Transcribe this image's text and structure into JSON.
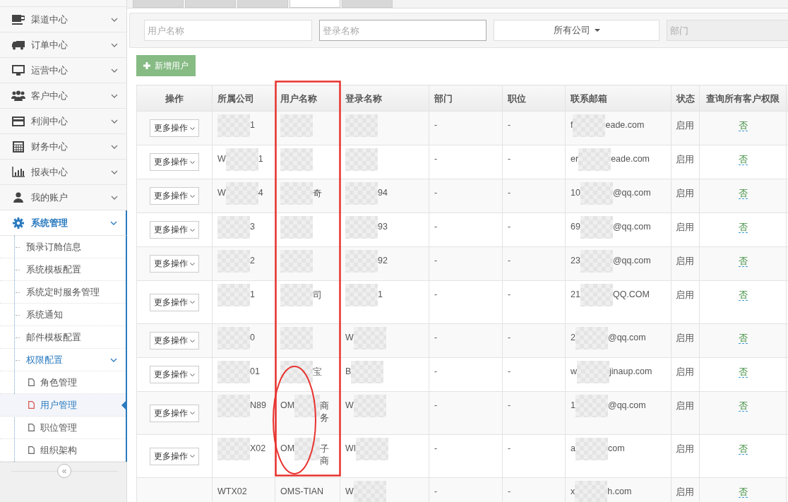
{
  "sidebar": {
    "items": [
      {
        "label": "渠道中心",
        "selected": false
      },
      {
        "label": "订单中心",
        "selected": false
      },
      {
        "label": "运营中心",
        "selected": false
      },
      {
        "label": "客户中心",
        "selected": false
      },
      {
        "label": "利润中心",
        "selected": false
      },
      {
        "label": "财务中心",
        "selected": false
      },
      {
        "label": "报表中心",
        "selected": false
      },
      {
        "label": "我的账户",
        "selected": false
      },
      {
        "label": "系统管理",
        "selected": true,
        "expanded": true,
        "children": [
          {
            "label": "预录订舱信息",
            "selected": false
          },
          {
            "label": "系统模板配置",
            "selected": false
          },
          {
            "label": "系统定时服务管理",
            "selected": false
          },
          {
            "label": "系统通知",
            "selected": false
          },
          {
            "label": "邮件模板配置",
            "selected": false
          },
          {
            "label": "权限配置",
            "selected": true,
            "expanded": true,
            "children": [
              {
                "label": "角色管理",
                "selected": false
              },
              {
                "label": "用户管理",
                "selected": true
              },
              {
                "label": "职位管理",
                "selected": false
              },
              {
                "label": "组织架构",
                "selected": false
              }
            ]
          }
        ]
      }
    ],
    "collapse_button": "«"
  },
  "tabs": [
    {
      "selected": false
    },
    {
      "selected": false
    },
    {
      "selected": false
    },
    {
      "selected": true
    },
    {
      "selected": false
    }
  ],
  "filters": {
    "user_name": {
      "placeholder": "用户名称"
    },
    "login_name": {
      "placeholder": "登录名称"
    },
    "company": {
      "value": "所有公司"
    },
    "department": {
      "placeholder": "部门",
      "disabled": true
    }
  },
  "add_button": "新增用户",
  "table": {
    "columns": [
      "操作",
      "所属公司",
      "用户名称",
      "登录名称",
      "部门",
      "职位",
      "联系邮箱",
      "状态",
      "查询所有客户权限"
    ],
    "rows": [
      {
        "action": "更多操作",
        "company": {
          "tail": "1"
        },
        "user_name": {},
        "login_name": {},
        "department": "-",
        "position": "-",
        "email": {
          "head": "f",
          "tail": "eade.com"
        },
        "status": "启用",
        "permission": "否"
      },
      {
        "action": "更多操作",
        "company": {
          "head": "W",
          "tail": "1"
        },
        "user_name": {},
        "login_name": {},
        "department": "-",
        "position": "-",
        "email": {
          "head": "er",
          "tail": "eade.com"
        },
        "status": "启用",
        "permission": "否"
      },
      {
        "action": "更多操作",
        "company": {
          "head": "W",
          "tail": "4"
        },
        "user_name": {
          "tail": "奇"
        },
        "login_name": {
          "tail": "94"
        },
        "department": "-",
        "position": "-",
        "email": {
          "head": "10",
          "tail": "@qq.com"
        },
        "status": "启用",
        "permission": "否"
      },
      {
        "action": "更多操作",
        "company": {
          "tail": "3"
        },
        "user_name": {},
        "login_name": {
          "tail": "93"
        },
        "department": "-",
        "position": "-",
        "email": {
          "head": "69",
          "tail": "@qq.com"
        },
        "status": "启用",
        "permission": "否"
      },
      {
        "action": "更多操作",
        "company": {
          "tail": "2"
        },
        "user_name": {},
        "login_name": {
          "tail": "92"
        },
        "department": "-",
        "position": "-",
        "email": {
          "head": "23",
          "tail": "@qq.com"
        },
        "status": "启用",
        "permission": "否"
      },
      {
        "action": "更多操作",
        "company": {
          "tail": "1"
        },
        "user_name": {
          "tail": "司"
        },
        "login_name": {
          "tail": "1"
        },
        "department": "-",
        "position": "-",
        "email": {
          "head": "21",
          "tail": "QQ.COM"
        },
        "status": "启用",
        "permission": "否"
      },
      {
        "action": "更多操作",
        "company": {
          "tail": "0"
        },
        "user_name": {},
        "login_name": {
          "head": "W"
        },
        "department": "-",
        "position": "-",
        "email": {
          "head": "2",
          "tail": "@qq.com"
        },
        "status": "启用",
        "permission": "否"
      },
      {
        "action": "更多操作",
        "company": {
          "tail": "01"
        },
        "user_name": {
          "tail": "宝"
        },
        "login_name": {
          "head": "B"
        },
        "department": "-",
        "position": "-",
        "email": {
          "head": "w",
          "tail": "jinaup.com"
        },
        "status": "启用",
        "permission": "否"
      },
      {
        "action": "更多操作",
        "company": {
          "tail": "N89"
        },
        "user_name": {
          "head": "OM",
          "tail": "商务"
        },
        "login_name": {
          "head": "W"
        },
        "department": "-",
        "position": "-",
        "email": {
          "head": "1",
          "tail": "@qq.com"
        },
        "status": "启用",
        "permission": "否"
      },
      {
        "action": "更多操作",
        "company": {
          "tail": "X02"
        },
        "user_name": {
          "head": "OM",
          "tail": "子商"
        },
        "login_name": {
          "head": "WI"
        },
        "department": "-",
        "position": "-",
        "email": {
          "head": "a",
          "tail": "com"
        },
        "status": "启用",
        "permission": "否"
      },
      {
        "company": "WTX02",
        "user_name": "OMS-TIAN",
        "login_name": {
          "head": "W"
        },
        "department": "-",
        "position": "-",
        "email": {
          "head": "x",
          "tail": "h.com"
        },
        "status": "启用",
        "permission": "否"
      }
    ]
  }
}
